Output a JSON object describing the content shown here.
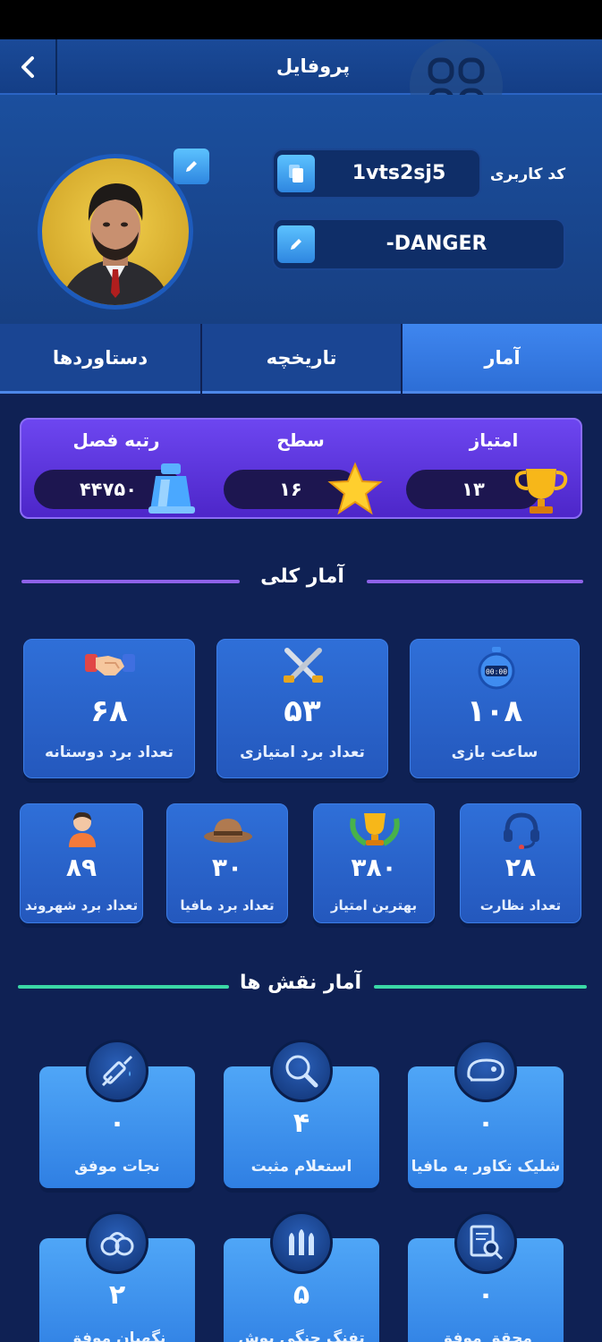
{
  "header": {
    "title": "پروفایل",
    "user_code_label": "کد کاربری",
    "user_code": "1vts2sj5",
    "nickname": "-DANGER"
  },
  "tabs": [
    {
      "label": "آمار",
      "active": true
    },
    {
      "label": "تاریخچه",
      "active": false
    },
    {
      "label": "دستاوردها",
      "active": false
    }
  ],
  "summary": {
    "score_label": "امتیاز",
    "score_value": "۱۳",
    "level_label": "سطح",
    "level_value": "۱۶",
    "rank_label": "رتبه فصل",
    "rank_value": "۴۴۷۵۰"
  },
  "general": {
    "title": "آمار کلی",
    "stats": [
      {
        "icon": "stopwatch-icon",
        "value": "۱۰۸",
        "label": "ساعت بازی"
      },
      {
        "icon": "crossed-swords-icon",
        "value": "۵۳",
        "label": "تعداد برد امتیازی"
      },
      {
        "icon": "handshake-icon",
        "value": "۶۸",
        "label": "تعداد برد دوستانه"
      },
      {
        "icon": "headset-icon",
        "value": "۲۸",
        "label": "تعداد نظارت"
      },
      {
        "icon": "trophy-laurel-icon",
        "value": "۳۸۰",
        "label": "بهترین امتیاز"
      },
      {
        "icon": "hat-icon",
        "value": "۳۰",
        "label": "تعداد برد مافیا"
      },
      {
        "icon": "citizen-icon",
        "value": "۸۹",
        "label": "تعداد برد شهروند"
      }
    ]
  },
  "roles": {
    "title": "آمار نقش ها",
    "stats": [
      {
        "icon": "beret-icon",
        "value": "۰",
        "label": "شلیک تکاور به مافیا"
      },
      {
        "icon": "magnifier-icon",
        "value": "۴",
        "label": "استعلام مثبت"
      },
      {
        "icon": "syringe-icon",
        "value": "۰",
        "label": "نجات موفق"
      },
      {
        "icon": "document-search-icon",
        "value": "۰",
        "label": "محقق موفق"
      },
      {
        "icon": "bullets-icon",
        "value": "۵",
        "label": "تفنگ جنگی بوش مند"
      },
      {
        "icon": "handcuffs-icon",
        "value": "۲",
        "label": "نگهبان موفق"
      }
    ]
  },
  "colors": {
    "background": "#0f2154",
    "accent_blue": "#2f6fd8",
    "purple": "#5c35dd",
    "green_line": "#3ad8a6",
    "purple_line": "#8e62e8"
  }
}
